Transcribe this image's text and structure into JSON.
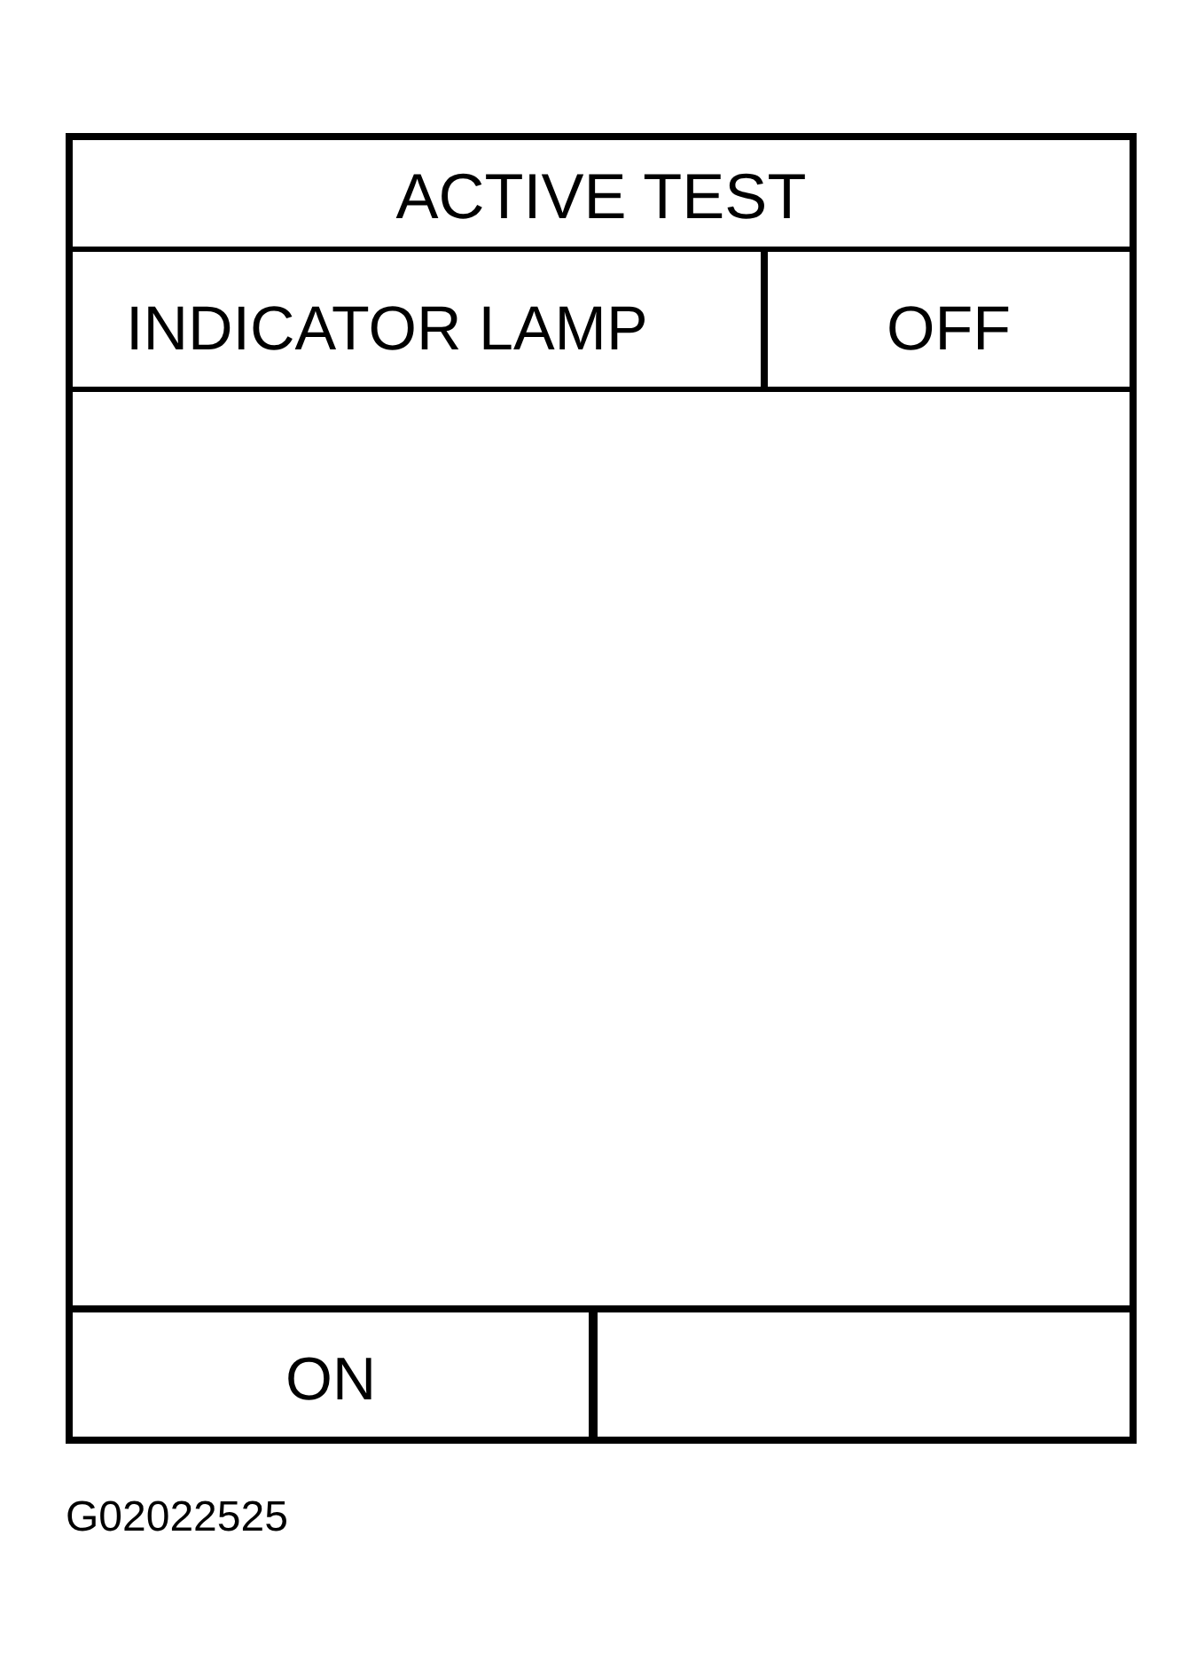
{
  "screen": {
    "title": "ACTIVE TEST",
    "item": {
      "label": "INDICATOR LAMP",
      "value": "OFF"
    },
    "softkeys": [
      {
        "label": "ON"
      }
    ]
  },
  "figure_id": "G02022525"
}
